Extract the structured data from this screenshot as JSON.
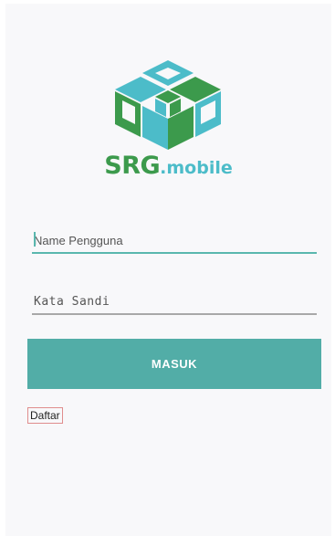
{
  "brand": {
    "srg": "SRG",
    "mobile": ".mobile",
    "colors": {
      "green": "#3c9a4c",
      "teal": "#4cbcc9"
    },
    "logo_icon": "cube-logo-icon"
  },
  "login": {
    "username_placeholder": "Name Pengguna",
    "password_placeholder": "Kata Sandi",
    "submit_label": "MASUK",
    "register_label": "Daftar",
    "accent_color": "#52ada7"
  }
}
